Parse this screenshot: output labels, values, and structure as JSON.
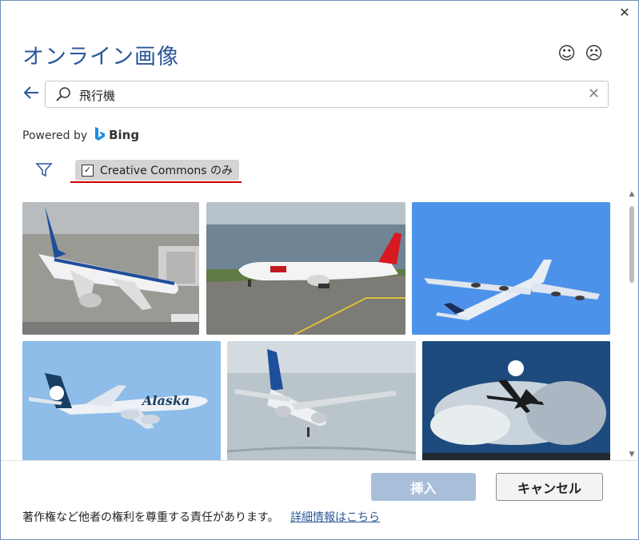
{
  "dialog": {
    "title": "オンライン画像",
    "close_icon": "close-icon",
    "feedback": {
      "smile_icon": "smile-icon",
      "frown_icon": "frown-icon"
    }
  },
  "search": {
    "back_icon": "back-arrow-icon",
    "value": "飛行機",
    "clear_icon": "clear-icon"
  },
  "powered_by": {
    "label": "Powered by",
    "brand": "Bing"
  },
  "filters": {
    "creative_commons_label": "Creative Commons のみ",
    "checked": true
  },
  "images": [
    {
      "subject": "ANA airliner parked at gate"
    },
    {
      "subject": "JAL airliner on taxiway"
    },
    {
      "subject": "airliner in blue sky"
    },
    {
      "subject": "Alaska Airlines plane in flight"
    },
    {
      "subject": "ANA plane landing"
    },
    {
      "subject": "plane silhouette against sun and clouds"
    }
  ],
  "buttons": {
    "insert": "挿入",
    "cancel": "キャンセル"
  },
  "footer": {
    "notice": "著作権など他者の権利を尊重する責任があります。",
    "link": "詳細情報はこちら"
  },
  "colors": {
    "accent": "#2b579a",
    "highlight": "#d00000",
    "insert_disabled": "#a9bfd9"
  }
}
